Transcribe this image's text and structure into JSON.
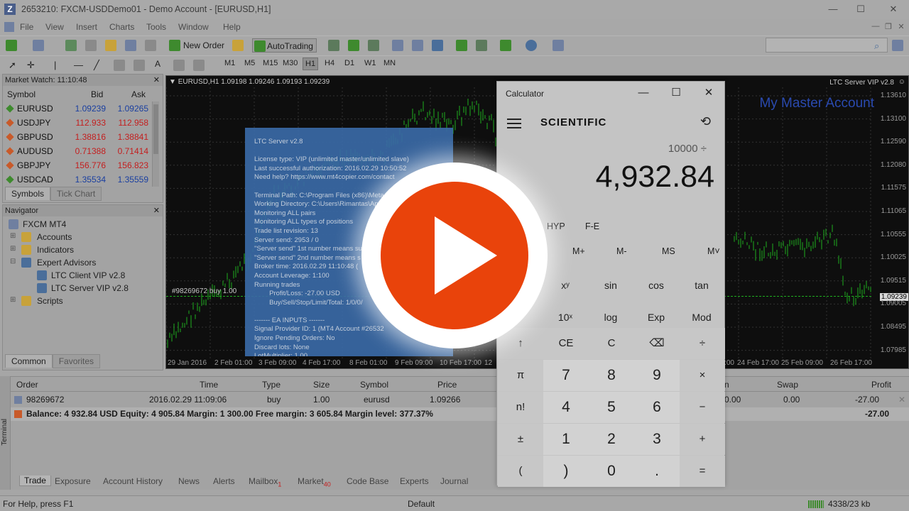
{
  "window": {
    "title": "2653210: FXCM-USDDemo01 - Demo Account - [EURUSD,H1]",
    "logo": "Z",
    "controls": [
      "—",
      "☐",
      "✕"
    ]
  },
  "menu": [
    "File",
    "View",
    "Insert",
    "Charts",
    "Tools",
    "Window",
    "Help"
  ],
  "mdi_controls": [
    "—",
    "❐",
    "✕"
  ],
  "toolbar": {
    "new_order": "New Order",
    "autotrading": "AutoTrading",
    "timeframes": [
      "M1",
      "M5",
      "M15",
      "M30",
      "H1",
      "H4",
      "D1",
      "W1",
      "MN"
    ],
    "active_timeframe": "H1",
    "search_placeholder": ""
  },
  "market_watch": {
    "title": "Market Watch: 11:10:48",
    "headers": {
      "symbol": "Symbol",
      "bid": "Bid",
      "ask": "Ask"
    },
    "rows": [
      {
        "symbol": "EURUSD",
        "bid": "1.09239",
        "ask": "1.09265",
        "dir": "up"
      },
      {
        "symbol": "USDJPY",
        "bid": "112.933",
        "ask": "112.958",
        "dir": "down"
      },
      {
        "symbol": "GBPUSD",
        "bid": "1.38816",
        "ask": "1.38841",
        "dir": "down"
      },
      {
        "symbol": "AUDUSD",
        "bid": "0.71388",
        "ask": "0.71414",
        "dir": "down"
      },
      {
        "symbol": "GBPJPY",
        "bid": "156.776",
        "ask": "156.823",
        "dir": "down"
      },
      {
        "symbol": "USDCAD",
        "bid": "1.35534",
        "ask": "1.35559",
        "dir": "up"
      }
    ],
    "tabs": [
      "Symbols",
      "Tick Chart"
    ]
  },
  "navigator": {
    "title": "Navigator",
    "items": [
      "FXCM MT4",
      "Accounts",
      "Indicators",
      "Expert Advisors",
      "LTC Client VIP v2.8",
      "LTC Server VIP v2.8",
      "Scripts"
    ],
    "tabs": [
      "Common",
      "Favorites"
    ]
  },
  "chart": {
    "header": "EURUSD,H1  1.09198 1.09246 1.09193 1.09239",
    "ea_label": "LTC Server VIP v2.8",
    "account_label": "My Master Account",
    "order_line_label": "#98269672 buy 1.00",
    "current_price": "1.09239",
    "price_labels": [
      "1.13610",
      "1.13100",
      "1.12590",
      "1.12080",
      "1.11575",
      "1.11065",
      "1.10555",
      "1.10025",
      "1.09515",
      "1.09005",
      "1.08495",
      "1.07985"
    ],
    "time_labels": [
      "29 Jan 2016",
      "2 Feb 01:00",
      "3 Feb 09:00",
      "4 Feb 17:00",
      "8 Feb 01:00",
      "9 Feb 09:00",
      "10 Feb 17:00",
      "12",
      "23 Feb 17:00",
      "24 Feb 17:00",
      "25 Feb 09:00",
      "26 Feb 17:00"
    ],
    "indicators": [
      "↓",
      "↑",
      "☺"
    ]
  },
  "ltc_panel": {
    "lines": [
      "LTC Server v2.8",
      "",
      "License type: VIP (unlimited master/unlimited slave)",
      "Last successful authorization: 2016.02.29 10:50:52",
      "Need help? https://www.mt4copier.com/contact",
      "",
      "Terminal Path: C:\\Program Files (x86)\\Meta",
      "Working Directory: C:\\Users\\Rimantas\\Ap",
      "Monitoring ALL pairs",
      "Monitoring ALL types of positions",
      "Trade list revision: 13",
      "Server send: 2953 / 0",
      "\"Server send\" 1st number means su",
      "\"Server send\" 2nd number means s",
      "Broker time: 2016.02.29 11:10:48 (",
      "Account Leverage: 1:100",
      "Running trades",
      "        Profit/Loss: -27.00 USD",
      "        Buy/Sell/Stop/Limit/Total: 1/0/0/",
      "",
      "------- EA INPUTS -------",
      "Signal Provider ID: 1 (MT4 Account #26532",
      "Ignore Pending Orders: No",
      "Discard lots: None",
      "LotMultiplier: 1.00",
      "Round Slip: 1.00    TakeProfitMultiplier: 1.00"
    ]
  },
  "terminal": {
    "side_label": "Terminal",
    "headers": {
      "order": "Order",
      "time": "Time",
      "type": "Type",
      "size": "Size",
      "symbol": "Symbol",
      "price": "Price",
      "commission": "n",
      "swap": "Swap",
      "profit": "Profit"
    },
    "rows": [
      {
        "order": "98269672",
        "time": "2016.02.29 11:09:06",
        "type": "buy",
        "size": "1.00",
        "symbol": "eurusd",
        "price": "1.09266",
        "commission": "0.00",
        "swap": "0.00",
        "profit": "-27.00"
      }
    ],
    "balance_line": "Balance: 4 932.84 USD  Equity: 4 905.84  Margin: 1 300.00  Free margin: 3 605.84  Margin level: 377.37%",
    "balance_profit": "-27.00",
    "tabs": [
      {
        "label": "Trade",
        "badge": ""
      },
      {
        "label": "Exposure",
        "badge": ""
      },
      {
        "label": "Account History",
        "badge": ""
      },
      {
        "label": "News",
        "badge": ""
      },
      {
        "label": "Alerts",
        "badge": ""
      },
      {
        "label": "Mailbox",
        "badge": "1"
      },
      {
        "label": "Market",
        "badge": "40"
      },
      {
        "label": "Code Base",
        "badge": ""
      },
      {
        "label": "Experts",
        "badge": ""
      },
      {
        "label": "Journal",
        "badge": ""
      }
    ]
  },
  "statusbar": {
    "help": "For Help, press F1",
    "profile": "Default",
    "traffic": "4338/23 kb"
  },
  "calculator": {
    "title": "Calculator",
    "mode": "SCIENTIFIC",
    "expression": "10000 ÷",
    "display": "4,932.84",
    "fn_row": [
      "HYP",
      "F-E"
    ],
    "memory_row": [
      "MR",
      "M+",
      "M-",
      "MS",
      "M˅"
    ],
    "sci_row1": [
      "xʸ",
      "sin",
      "cos",
      "tan"
    ],
    "sci_row2": [
      "10ˣ",
      "log",
      "Exp",
      "Mod"
    ],
    "keys": [
      [
        "↑",
        "CE",
        "C",
        "⌫",
        "÷"
      ],
      [
        "π",
        "7",
        "8",
        "9",
        "×"
      ],
      [
        "n!",
        "4",
        "5",
        "6",
        "−"
      ],
      [
        "±",
        "1",
        "2",
        "3",
        "+"
      ],
      [
        "(",
        ")",
        "0",
        ".",
        "="
      ]
    ]
  },
  "colors": {
    "up": "#3e8a2e",
    "down": "#c85a2a",
    "bid": "#1a3fa0",
    "ask": "#1a3fa0",
    "down_price": "#c41e1e",
    "candles": "#1fae1f",
    "play": "#e9430b",
    "ltc_panel": "#3a6aa6"
  },
  "icons": {
    "play_button": "play-icon",
    "calculator_history": "history-icon",
    "calculator_menu": "hamburger-icon"
  }
}
